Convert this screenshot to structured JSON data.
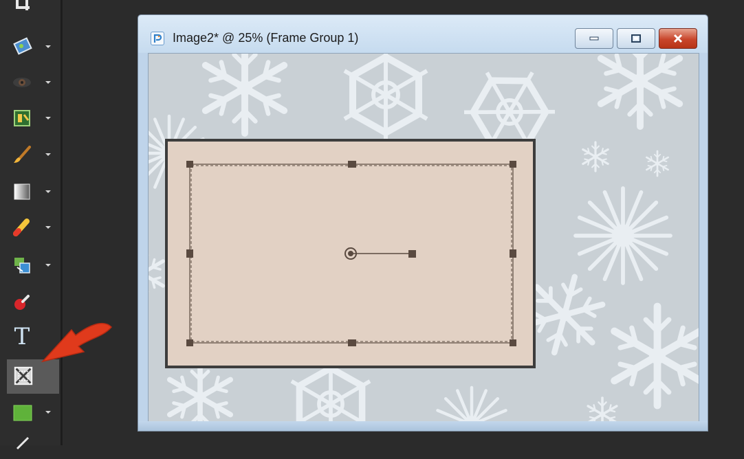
{
  "window": {
    "title": "Image2* @  25% (Frame Group 1)"
  },
  "toolbar": {
    "tools": [
      {
        "name": "crop-tool",
        "has_dropdown": false
      },
      {
        "name": "straighten-tool",
        "has_dropdown": true
      },
      {
        "name": "red-eye-tool",
        "has_dropdown": true
      },
      {
        "name": "clone-tool",
        "has_dropdown": true
      },
      {
        "name": "paint-brush-tool",
        "has_dropdown": true
      },
      {
        "name": "gradient-tool",
        "has_dropdown": true
      },
      {
        "name": "eraser-tool",
        "has_dropdown": true
      },
      {
        "name": "picture-tube-tool",
        "has_dropdown": true
      },
      {
        "name": "pushpin-tool",
        "has_dropdown": false
      },
      {
        "name": "text-tool",
        "label": "T",
        "has_dropdown": false
      },
      {
        "name": "frame-tool",
        "selected": true,
        "has_dropdown": false
      },
      {
        "name": "rectangle-tool",
        "has_dropdown": true
      },
      {
        "name": "pen-tool",
        "has_dropdown": false
      }
    ]
  },
  "canvas": {
    "background": "snowflakes",
    "frame_fill": "#e2d1c4",
    "frame_border": "#3d3d3d"
  },
  "annotation": {
    "arrow_color": "#e03a1c",
    "points_to": "frame-tool"
  }
}
